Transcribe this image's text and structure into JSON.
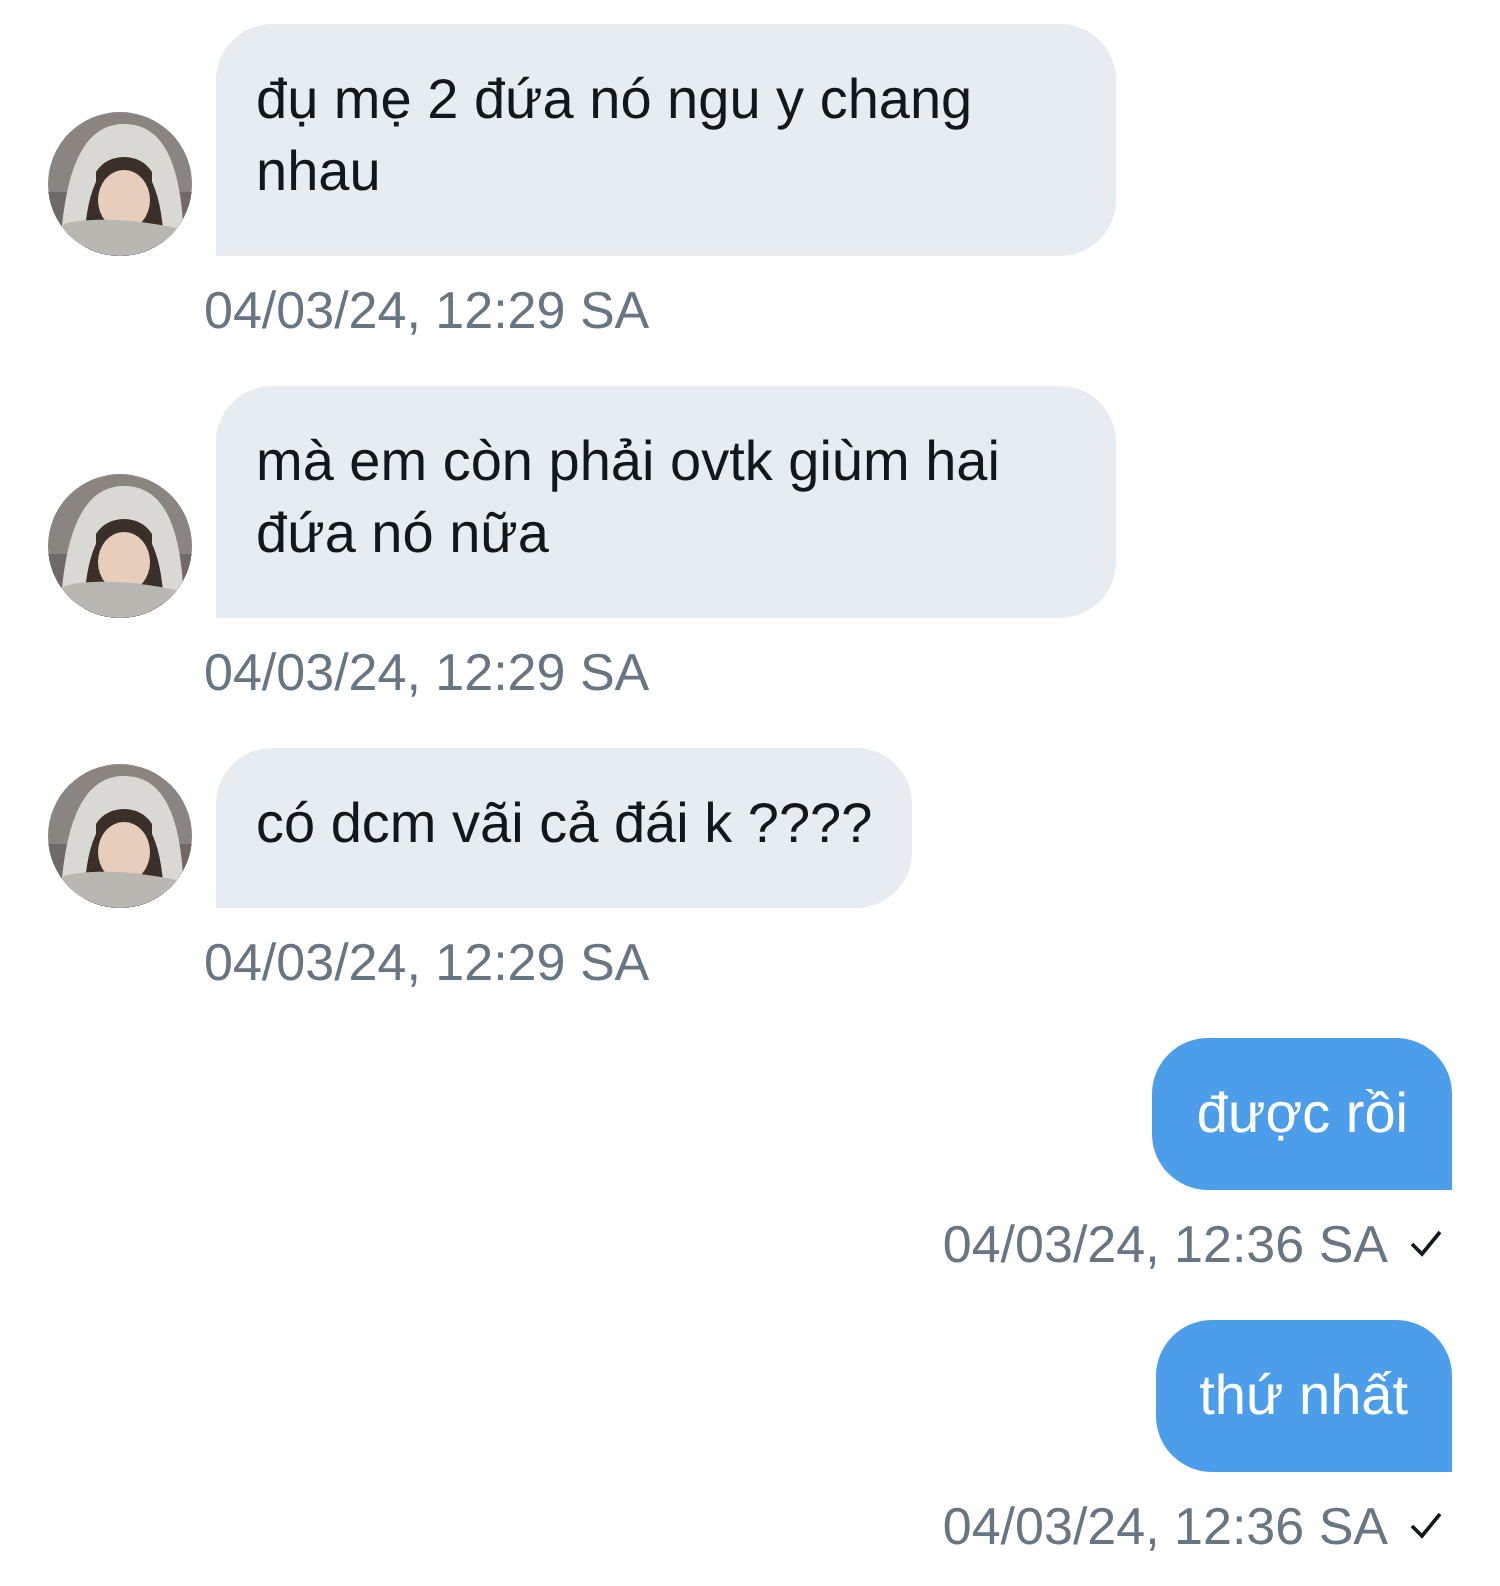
{
  "messages": [
    {
      "kind": "incoming",
      "text": "đụ mẹ 2 đứa nó ngu y chang nhau",
      "time": "04/03/24, 12:29 SA"
    },
    {
      "kind": "incoming",
      "text": "mà em còn phải ovtk giùm hai đứa nó nữa",
      "time": "04/03/24, 12:29 SA"
    },
    {
      "kind": "incoming",
      "text": "có dcm vãi cả đái k ????",
      "time": "04/03/24, 12:29 SA"
    },
    {
      "kind": "outgoing",
      "text": "được rồi",
      "time": "04/03/24, 12:36 SA",
      "sent": true
    },
    {
      "kind": "outgoing",
      "text": "thứ nhất",
      "time": "04/03/24, 12:36 SA",
      "sent": true
    }
  ]
}
